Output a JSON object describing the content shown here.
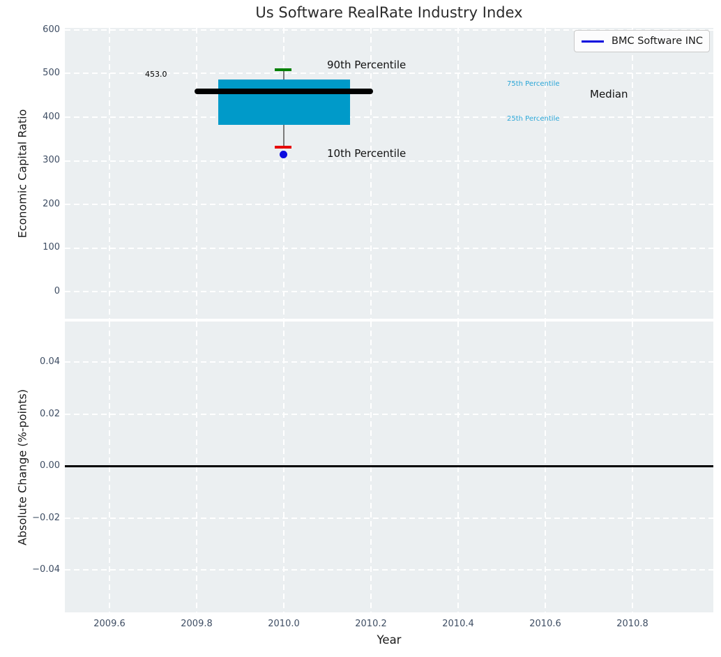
{
  "title": "Us Software RealRate Industry Index",
  "legend": {
    "label": "BMC Software INC",
    "line_color": "#0000dd"
  },
  "colors": {
    "axes_background": "#ebeff1",
    "grid": "#ffffff",
    "box_fill": "#009ac9",
    "median_line": "#000000",
    "p90_cap": "#008000",
    "p10_cap": "#e60000",
    "company_point": "#0b0bdf",
    "percentile_label_text": "#2aa5d6",
    "tick_text": "#3e4d63",
    "zero_line": "#000000"
  },
  "chart_data": [
    {
      "type": "box",
      "title": "Us Software RealRate Industry Index",
      "ylabel": "Economic Capital Ratio",
      "xlim": [
        2009.5,
        2010.99
      ],
      "ylim": [
        -62,
        605
      ],
      "grid": true,
      "legend_position": "upper right",
      "legend_entries": [
        "BMC Software INC"
      ],
      "boxes": [
        {
          "x": 2010.0,
          "box_x_span": [
            2009.85,
            2010.15
          ],
          "median_x_span": [
            2009.8,
            2010.2
          ],
          "p10": 332,
          "p25": 384,
          "median": 453,
          "p75": 484,
          "p90": 508
        }
      ],
      "points": [
        {
          "name": "BMC Software INC",
          "x": 2010.0,
          "y": 316
        }
      ],
      "labels": {
        "median_value": "453.0",
        "p90": "90th Percentile",
        "p10": "10th Percentile",
        "p75": "75th Percentile",
        "p25": "25th Percentile",
        "median": "Median"
      },
      "yticks": [
        "600",
        "500",
        "400",
        "300",
        "200",
        "100",
        "0"
      ]
    },
    {
      "type": "line",
      "ylabel": "Absolute Change (%-points)",
      "xlabel": "Year",
      "xlim": [
        2009.5,
        2010.99
      ],
      "ylim": [
        -0.056,
        0.056
      ],
      "grid": true,
      "zero_line": 0.0,
      "series": [],
      "yticks": [
        "0.04",
        "0.02",
        "0.00",
        "−0.02",
        "−0.04"
      ],
      "xticks": [
        "2009.6",
        "2009.8",
        "2010.0",
        "2010.2",
        "2010.4",
        "2010.6",
        "2010.8"
      ]
    }
  ]
}
